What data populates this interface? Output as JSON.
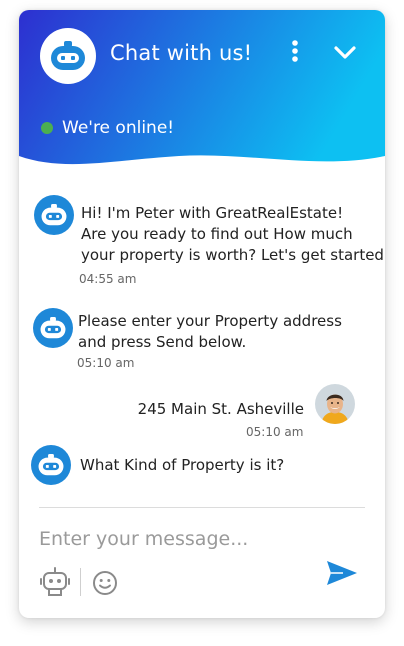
{
  "header": {
    "title": "Chat with us!",
    "status": "We're online!",
    "gradient_start": "#2d2fd0",
    "gradient_end": "#0dc0f2",
    "status_color": "#4caf50",
    "menu_icon": "kebab-menu-icon",
    "collapse_icon": "chevron-down-icon"
  },
  "messages": [
    {
      "sender": "bot",
      "lines": [
        "Hi! I'm Peter with GreatRealEstate!",
        "Are you ready to find out How much",
        "your property is worth? Let's get started"
      ],
      "time": "04:55 am"
    },
    {
      "sender": "bot",
      "lines": [
        "Please enter your Property address",
        "and press Send below."
      ],
      "time": "05:10 am"
    },
    {
      "sender": "user",
      "lines": [
        "245 Main St. Asheville"
      ],
      "time": "05:10 am"
    },
    {
      "sender": "bot",
      "lines": [
        "What Kind of Property is it?"
      ]
    }
  ],
  "composer": {
    "placeholder": "Enter your message...",
    "bot_icon": "robot-icon",
    "emoji_icon": "smiley-icon",
    "send_icon": "send-icon",
    "accent": "#1e88d8"
  }
}
